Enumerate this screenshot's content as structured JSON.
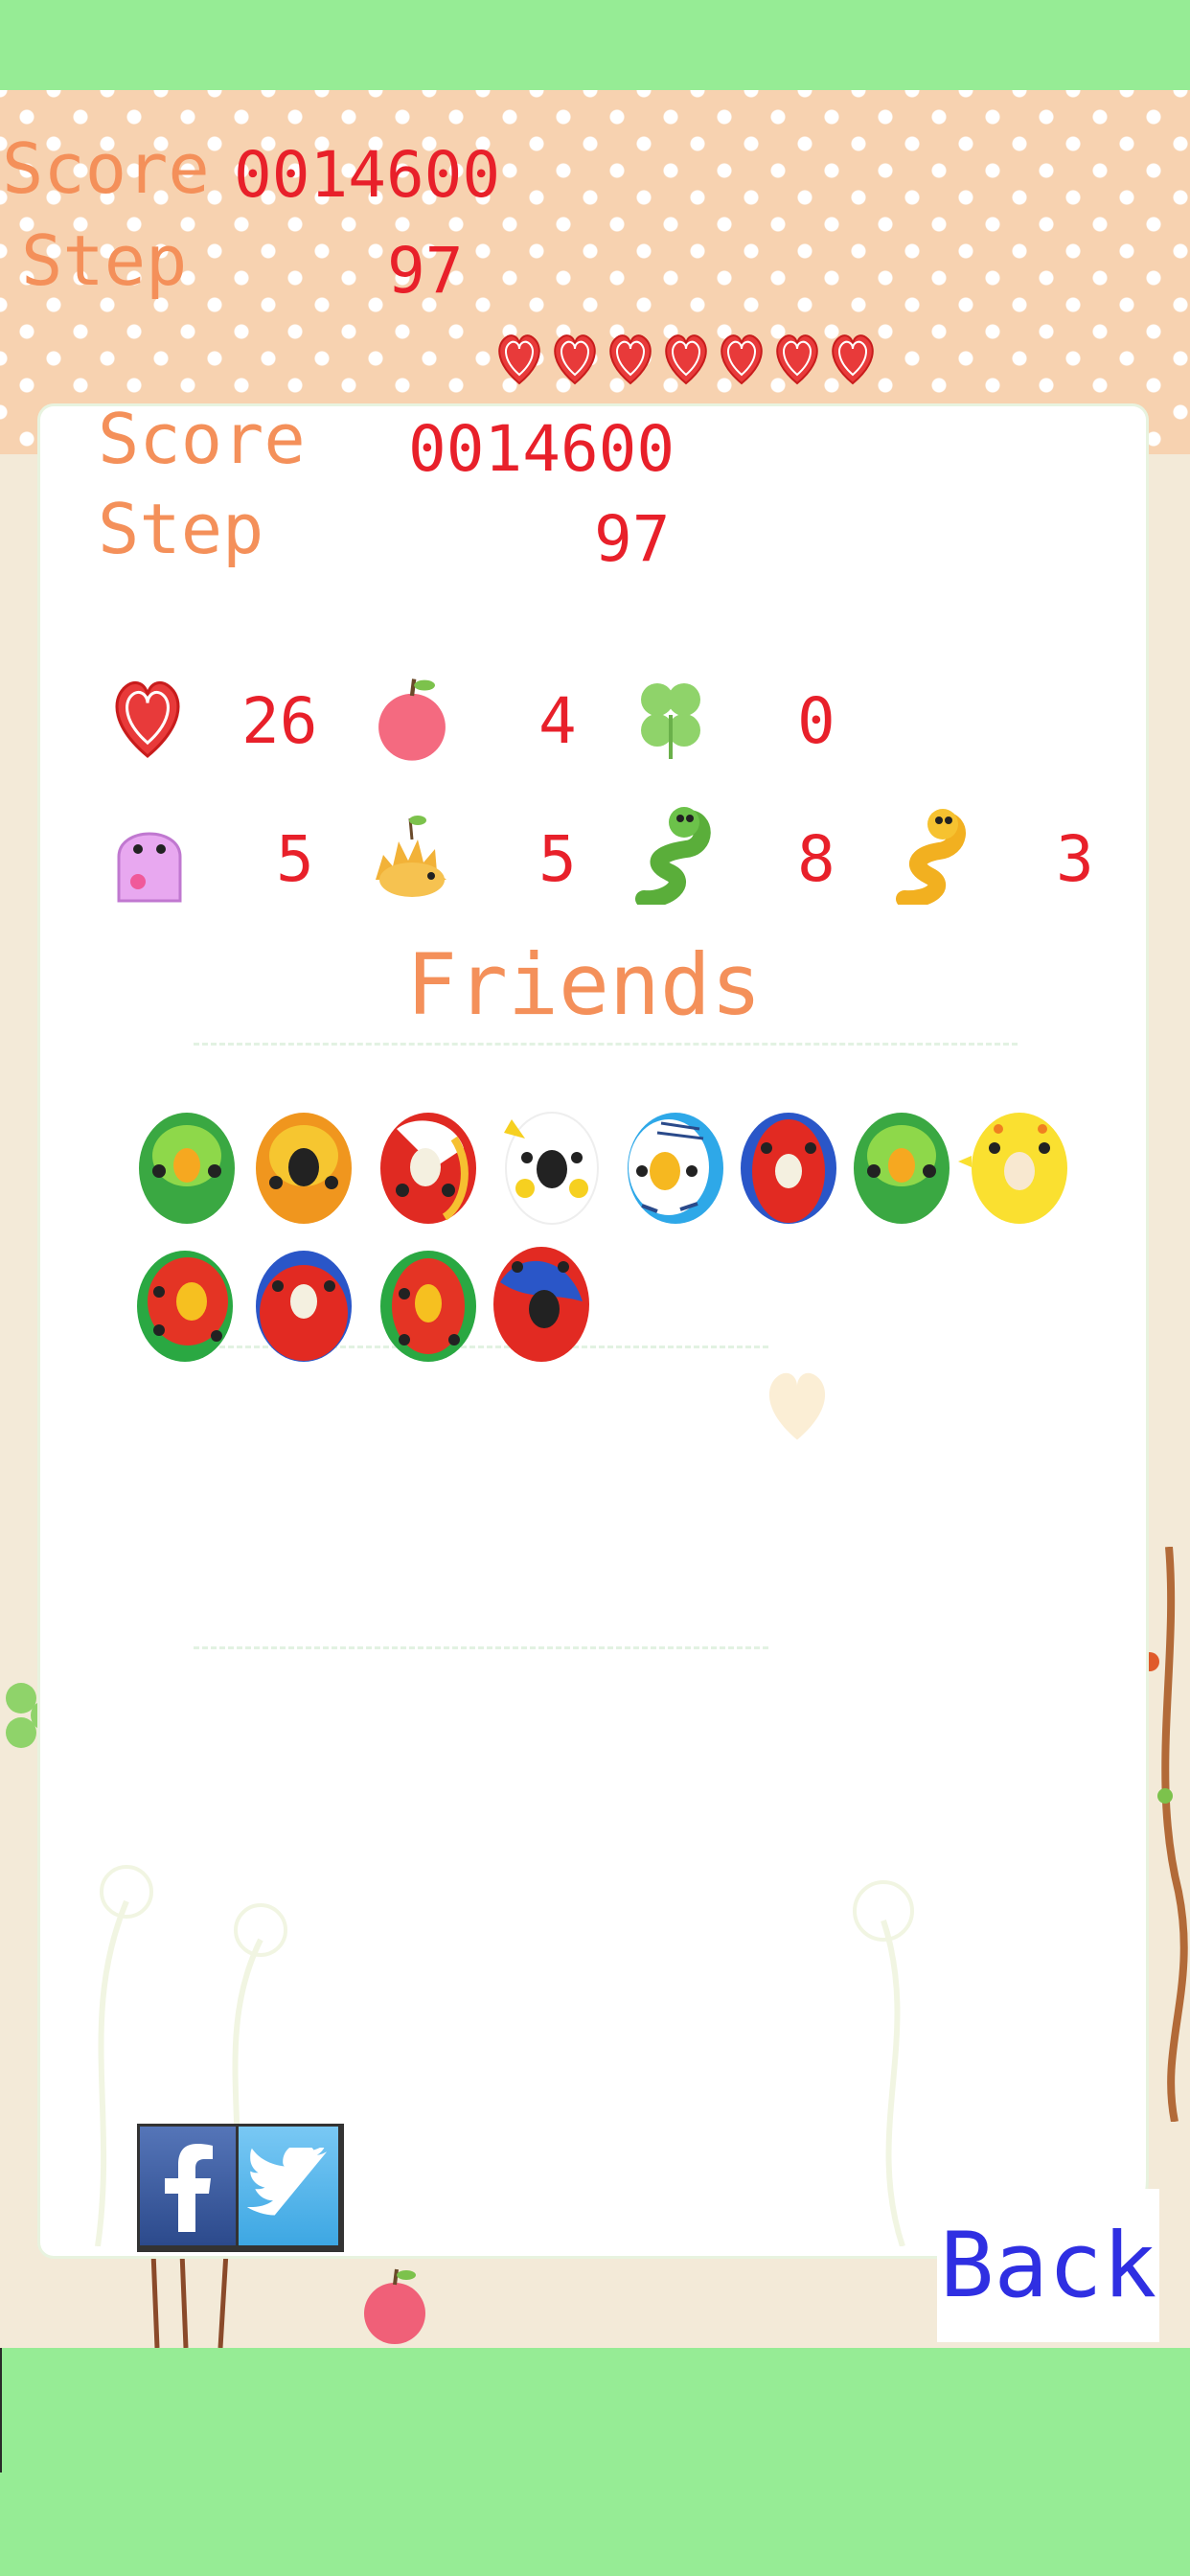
{
  "hud": {
    "score_label": "Score",
    "score_value": "0014600",
    "step_label": "Step",
    "step_value": "97",
    "hearts": [
      "heart-icon",
      "heart-icon",
      "heart-icon",
      "heart-icon",
      "heart-icon",
      "heart-icon",
      "heart-icon"
    ]
  },
  "result": {
    "score_label": "Score",
    "score_value": "0014600",
    "step_label": "Step",
    "step_value": "97",
    "items_row1": [
      {
        "icon": "heart-icon",
        "count": "26"
      },
      {
        "icon": "apple-icon",
        "count": "4"
      },
      {
        "icon": "clover-icon",
        "count": "0"
      }
    ],
    "items_row2": [
      {
        "icon": "pink-monster-icon",
        "count": "5"
      },
      {
        "icon": "hedgehog-icon",
        "count": "5"
      },
      {
        "icon": "green-snake-icon",
        "count": "8"
      },
      {
        "icon": "yellow-snake-icon",
        "count": "3"
      }
    ],
    "friends_title": "Friends",
    "friends": [
      "green-parrot-icon",
      "orange-parrot-icon",
      "red-parrot-icon",
      "white-cockatoo-icon",
      "blue-budgie-icon",
      "red-blue-parrot-icon",
      "green-parrot-icon",
      "yellow-chick-icon",
      "red-green-parrot-icon",
      "red-blue-parrot-icon",
      "green-red-parrot-icon",
      "red-black-parrot-icon"
    ]
  },
  "share": {
    "facebook": "facebook-icon",
    "twitter": "twitter-icon"
  },
  "back_label": "Back",
  "colors": {
    "accent_green": "#96ec95",
    "label_orange": "#f4905a",
    "value_red": "#e8202a",
    "back_blue": "#2f2fe2"
  }
}
